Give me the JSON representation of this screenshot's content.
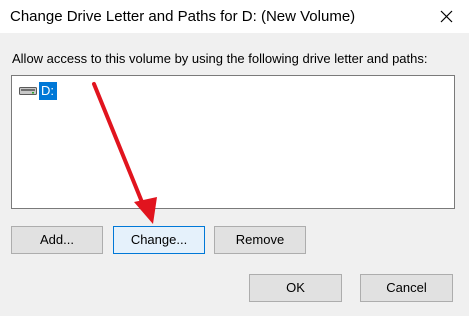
{
  "window": {
    "title": "Change Drive Letter and Paths for D: (New Volume)",
    "close_icon": "close-icon"
  },
  "prompt": "Allow access to this volume by using the following drive letter and paths:",
  "paths_list": {
    "items": [
      {
        "label": "D:",
        "icon": "drive-icon",
        "selected": true
      }
    ]
  },
  "buttons": {
    "add": "Add...",
    "change": "Change...",
    "remove": "Remove",
    "ok": "OK",
    "cancel": "Cancel"
  },
  "annotation": {
    "arrow_color": "#e1141e",
    "points_to": "change-button"
  },
  "colors": {
    "selection": "#0078d7",
    "dialog_background": "#f0f0f0"
  }
}
